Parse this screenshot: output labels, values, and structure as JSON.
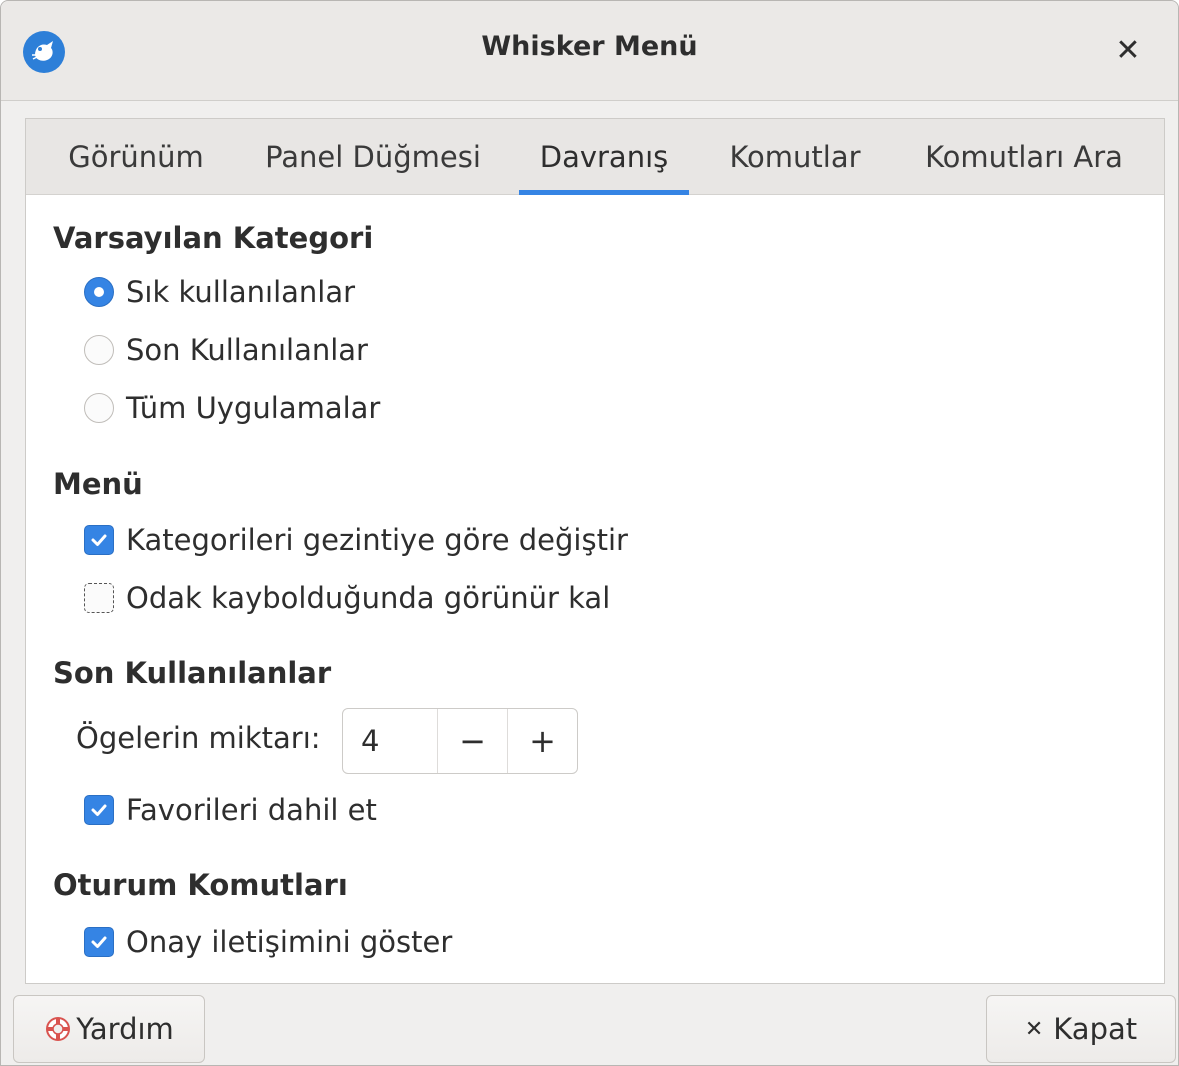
{
  "window": {
    "title": "Whisker Menü",
    "close_icon": "close-icon",
    "app_icon": "whisker-menu-icon"
  },
  "tabs": [
    {
      "label": "Görünüm",
      "active": false
    },
    {
      "label": "Panel Düğmesi",
      "active": false
    },
    {
      "label": "Davranış",
      "active": true
    },
    {
      "label": "Komutlar",
      "active": false
    },
    {
      "label": "Komutları Ara",
      "active": false
    }
  ],
  "default_category": {
    "heading": "Varsayılan Kategori",
    "options": [
      {
        "label": "Sık kullanılanlar",
        "selected": true
      },
      {
        "label": "Son Kullanılanlar",
        "selected": false
      },
      {
        "label": "Tüm Uygulamalar",
        "selected": false
      }
    ]
  },
  "menu": {
    "heading": "Menü",
    "options": [
      {
        "label": "Kategorileri gezintiye göre değiştir",
        "checked": true
      },
      {
        "label": "Odak kaybolduğunda görünür kal",
        "checked": false
      }
    ]
  },
  "recent": {
    "heading": "Son Kullanılanlar",
    "amount_label": "Ögelerin miktarı:",
    "amount_value": "4",
    "minus": "−",
    "plus": "+",
    "include_favorites": {
      "label": "Favorileri dahil et",
      "checked": true
    }
  },
  "session": {
    "heading": "Oturum Komutları",
    "confirm": {
      "label": "Onay iletişimini göster",
      "checked": true
    }
  },
  "footer": {
    "help_label": "Yardım",
    "help_icon": "lifebuoy-icon",
    "close_label": "Kapat",
    "close_icon": "close-icon"
  },
  "colors": {
    "accent": "#3584e4"
  }
}
